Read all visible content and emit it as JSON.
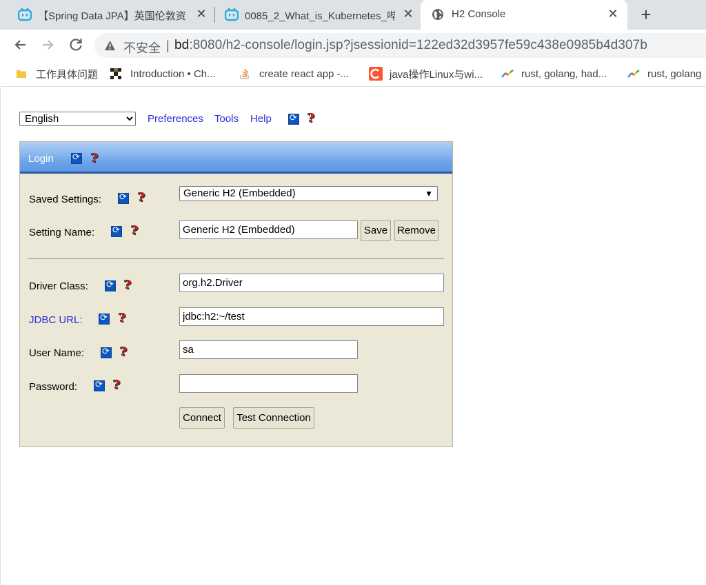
{
  "browser": {
    "tabs": [
      {
        "title": "【Spring Data JPA】英国伦敦资",
        "icon": "bilibili-icon"
      },
      {
        "title": "0085_2_What_is_Kubernetes_哔",
        "icon": "bilibili-icon"
      },
      {
        "title": "H2 Console",
        "icon": "globe-icon"
      }
    ],
    "address": {
      "insecure_label": "不安全",
      "separator": "|",
      "host": "bd",
      "path": ":8080/h2-console/login.jsp?jsessionid=122ed32d3957fe59c438e0985b4d307b"
    },
    "bookmarks": [
      {
        "label": "工作具体问题",
        "icon": "folder-icon"
      },
      {
        "label": "Introduction • Ch...",
        "icon": "book-icon"
      },
      {
        "label": "create react app -...",
        "icon": "stackoverflow-icon"
      },
      {
        "label": "java操作Linux与wi...",
        "icon": "csdn-icon"
      },
      {
        "label": "rust, golang, had...",
        "icon": "trends-icon"
      },
      {
        "label": "rust, golang",
        "icon": "trends-icon"
      }
    ]
  },
  "h2": {
    "language": "English",
    "nav": {
      "preferences": "Preferences",
      "tools": "Tools",
      "help": "Help"
    },
    "login_title": "Login",
    "labels": {
      "saved_settings": "Saved Settings:",
      "setting_name": "Setting Name:",
      "driver_class": "Driver Class:",
      "jdbc_url": "JDBC URL:",
      "user_name": "User Name:",
      "password": "Password:"
    },
    "values": {
      "saved_settings": "Generic H2 (Embedded)",
      "setting_name": "Generic H2 (Embedded)",
      "driver_class": "org.h2.Driver",
      "jdbc_url": "jdbc:h2:~/test",
      "user_name": "sa",
      "password": ""
    },
    "buttons": {
      "save": "Save",
      "remove": "Remove",
      "connect": "Connect",
      "test_connection": "Test Connection"
    }
  }
}
